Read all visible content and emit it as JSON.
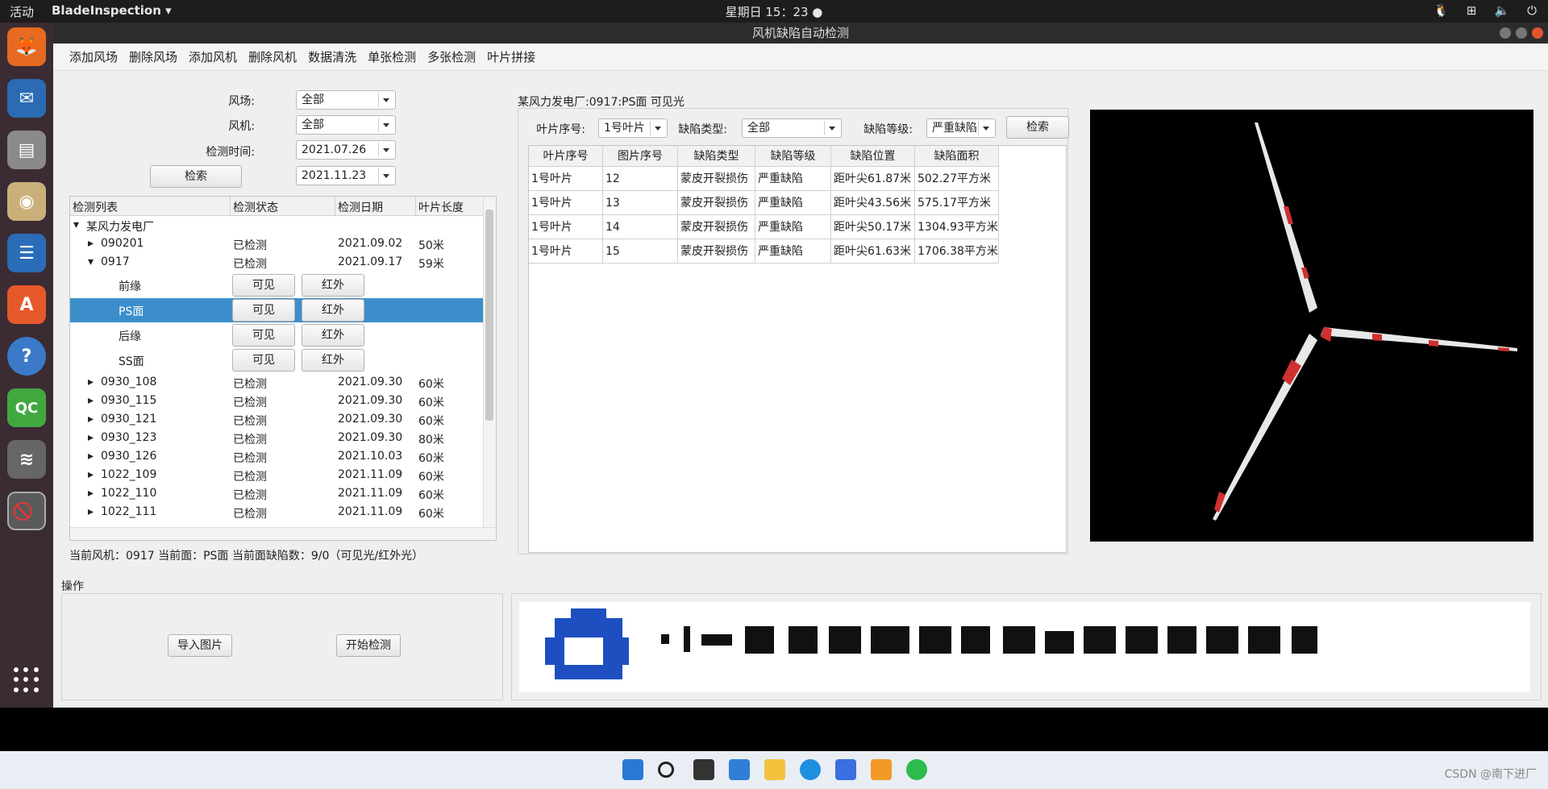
{
  "topbar": {
    "activities": "活动",
    "app_name": "BladeInspection ▾",
    "clock": "星期日 15：23 ●"
  },
  "window": {
    "title": "风机缺陷自动检测"
  },
  "menu": [
    "添加风场",
    "删除风场",
    "添加风机",
    "删除风机",
    "数据清洗",
    "单张检测",
    "多张检测",
    "叶片拼接"
  ],
  "filters": {
    "farm_label": "风场:",
    "farm_value": "全部",
    "turbine_label": "风机:",
    "turbine_value": "全部",
    "time_label": "检测时间:",
    "date_from": "2021.07.26",
    "date_to": "2021.11.23",
    "search_button": "检索"
  },
  "tree": {
    "headers": [
      "检测列表",
      "检测状态",
      "检测日期",
      "叶片长度"
    ],
    "root": "某风力发电厂",
    "rows": [
      {
        "name": "090201",
        "status": "已检测",
        "date": "2021.09.02",
        "length": "50米",
        "expanded": false
      },
      {
        "name": "0917",
        "status": "已检测",
        "date": "2021.09.17",
        "length": "59米",
        "expanded": true
      }
    ],
    "faces": [
      {
        "name": "前缘",
        "visible": "可见",
        "infrared": "红外"
      },
      {
        "name": "PS面",
        "visible": "可见",
        "infrared": "红外"
      },
      {
        "name": "后缘",
        "visible": "可见",
        "infrared": "红外"
      },
      {
        "name": "SS面",
        "visible": "可见",
        "infrared": "红外"
      }
    ],
    "rows2": [
      {
        "name": "0930_108",
        "status": "已检测",
        "date": "2021.09.30",
        "length": "60米"
      },
      {
        "name": "0930_115",
        "status": "已检测",
        "date": "2021.09.30",
        "length": "60米"
      },
      {
        "name": "0930_121",
        "status": "已检测",
        "date": "2021.09.30",
        "length": "60米"
      },
      {
        "name": "0930_123",
        "status": "已检测",
        "date": "2021.09.30",
        "length": "80米"
      },
      {
        "name": "0930_126",
        "status": "已检测",
        "date": "2021.10.03",
        "length": "60米"
      },
      {
        "name": "1022_109",
        "status": "已检测",
        "date": "2021.11.09",
        "length": "60米"
      },
      {
        "name": "1022_110",
        "status": "已检测",
        "date": "2021.11.09",
        "length": "60米"
      },
      {
        "name": "1022_111",
        "status": "已检测",
        "date": "2021.11.09",
        "length": "60米"
      }
    ]
  },
  "status_line": "当前风机：0917 当前面：PS面 当前面缺陷数：9/0（可见光/红外光）",
  "operations": {
    "label": "操作",
    "import_button": "导入图片",
    "start_button": "开始检测"
  },
  "detail": {
    "title": "某风力发电厂:0917:PS面 可见光",
    "blade_label": "叶片序号:",
    "blade_value": "1号叶片",
    "type_label": "缺陷类型:",
    "type_value": "全部",
    "level_label": "缺陷等级:",
    "level_value": "严重缺陷",
    "search_button": "检索",
    "headers": [
      "叶片序号",
      "图片序号",
      "缺陷类型",
      "缺陷等级",
      "缺陷位置",
      "缺陷面积"
    ],
    "rows": [
      [
        "1号叶片",
        "12",
        "蒙皮开裂损伤",
        "严重缺陷",
        "距叶尖61.87米",
        "502.27平方米"
      ],
      [
        "1号叶片",
        "13",
        "蒙皮开裂损伤",
        "严重缺陷",
        "距叶尖43.56米",
        "575.17平方米"
      ],
      [
        "1号叶片",
        "14",
        "蒙皮开裂损伤",
        "严重缺陷",
        "距叶尖50.17米",
        "1304.93平方米"
      ],
      [
        "1号叶片",
        "15",
        "蒙皮开裂损伤",
        "严重缺陷",
        "距叶尖61.63米",
        "1706.38平方米"
      ]
    ]
  },
  "watermark": "CSDN @南下进厂"
}
